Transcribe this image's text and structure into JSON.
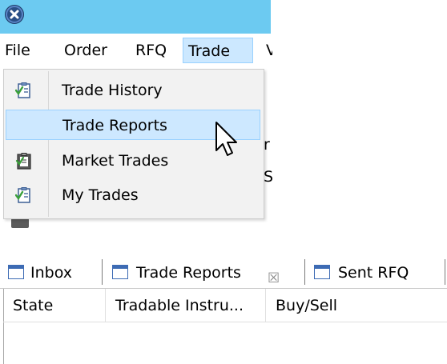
{
  "menu_bar": {
    "items": [
      "File",
      "Order",
      "RFQ",
      "Trade",
      "V"
    ]
  },
  "trade_menu": {
    "items": [
      {
        "label": "Trade History",
        "icon": "checklist-icon"
      },
      {
        "label": "Trade Reports",
        "icon": "",
        "highlighted": true
      },
      {
        "label": "Market Trades",
        "icon": "clipboard-icon"
      },
      {
        "label": "My Trades",
        "icon": "checklist-icon"
      }
    ]
  },
  "behind_fragments": [
    "r",
    "S"
  ],
  "tabs": [
    {
      "label": "Inbox",
      "icon": "list-icon"
    },
    {
      "label": "Trade Reports",
      "icon": "window-icon",
      "active": true,
      "close_glyph": "☒"
    },
    {
      "label": "Sent RFQ",
      "icon": "window-icon"
    }
  ],
  "table": {
    "columns": [
      "State",
      "Tradable Instru...",
      "Buy/Sell"
    ]
  },
  "colors": {
    "title_bar": "#6ccaf1",
    "menu_highlight": "#cce8ff",
    "menu_highlight_border": "#99d1ff",
    "dropdown_bg": "#f2f2f2",
    "tab_icon": "#3d6bb4"
  }
}
